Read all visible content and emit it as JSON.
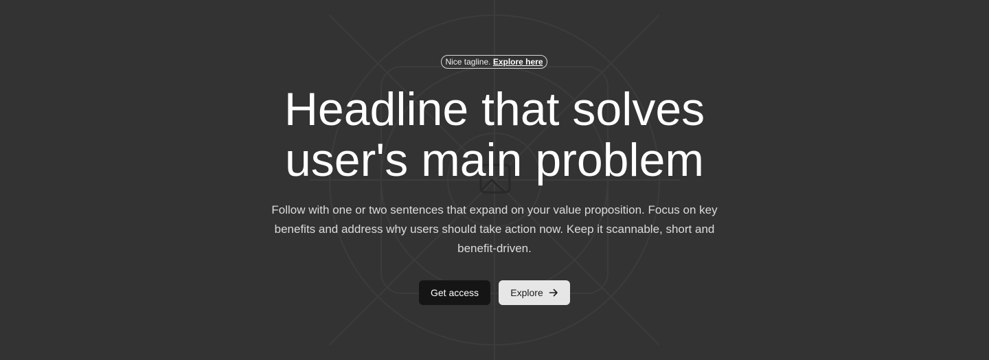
{
  "hero": {
    "tagline": {
      "text": "Nice tagline.",
      "link_label": "Explore here"
    },
    "headline": {
      "line1": "Headline that solves",
      "line2": "user's main problem"
    },
    "subtext": "Follow with one or two sentences that expand on your value proposition. Focus on key benefits and address why users should take action now. Keep it scannable, short and benefit-driven.",
    "buttons": {
      "primary_label": "Get access",
      "secondary_label": "Explore",
      "secondary_icon": "arrow-right-icon"
    },
    "background_art": "image-placeholder-icon"
  },
  "colors": {
    "background": "#333333",
    "headline": "#ffffff",
    "primary_button_bg": "#151515",
    "secondary_button_bg": "#e6e6e6"
  }
}
